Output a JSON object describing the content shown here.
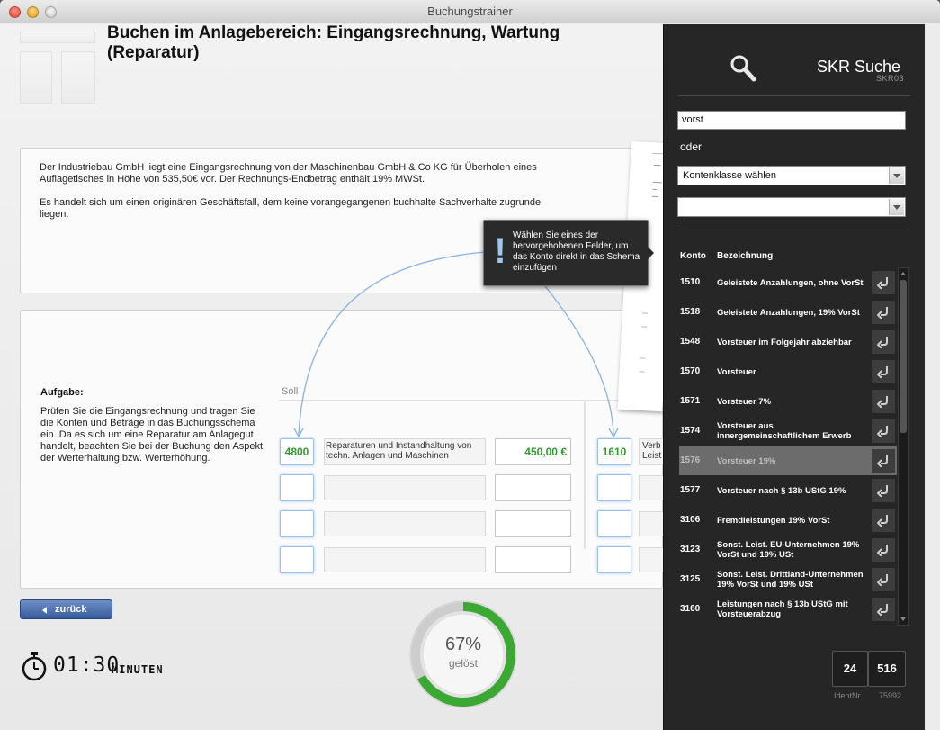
{
  "window": {
    "title": "Buchungstrainer"
  },
  "heading": "Buchen im Anlagebereich: Eingangsrechnung, Wartung (Reparatur)",
  "description": {
    "p1": "Der Industriebau GmbH liegt eine Eingangsrechnung von der Maschinenbau GmbH & Co KG für Überholen eines Auflagetisches in Höhe von 535,50€ vor. Der Rechnungs-Endbetrag enthält 19% MWSt.",
    "p2": "Es handelt sich um einen originären Geschäftsfall, dem keine vorangegangenen buchhalte Sachverhalte zugrunde liegen."
  },
  "task": {
    "label": "Aufgabe:",
    "text": "Prüfen Sie die Eingangsrechnung und tragen Sie die Konten und Beträge in das Buchungsschema ein. Da es sich um eine Reparatur am Anlagegut handelt, beachten Sie bei der Buchung den Aspekt der Werterhaltung bzw. Werterhöhung."
  },
  "schema": {
    "soll_label": "Soll",
    "row1": {
      "soll_account": "4800",
      "soll_description": "Reparaturen und Instandhaltung von techn. Anlagen und Maschinen",
      "soll_amount": "450,00 €",
      "haben_account": "1610",
      "haben_description_clipped": "Verb\nLeist"
    }
  },
  "tooltip": {
    "text": "Wählen Sie eines der hervorgehobenen Felder, um das Konto direkt in das Schema einzufügen"
  },
  "back_button": {
    "label": "zurück"
  },
  "timer": {
    "time": "01:30",
    "unit": "MINUTEN"
  },
  "progress": {
    "value": 0.67,
    "label": "67%",
    "sub": "gelöst",
    "color": "#3aa832"
  },
  "sidebar": {
    "title": "SKR Suche",
    "subtitle": "SKR03",
    "search_value": "vorst",
    "or_label": "oder",
    "class_select": "Kontenklasse wählen",
    "second_select": "",
    "columns": {
      "konto": "Konto",
      "bezeichnung": "Bezeichnung"
    },
    "rows": [
      {
        "konto": "1510",
        "bezeichnung": "Geleistete Anzahlungen, ohne VorSt"
      },
      {
        "konto": "1518",
        "bezeichnung": "Geleistete Anzahlungen, 19% VorSt"
      },
      {
        "konto": "1548",
        "bezeichnung": "Vorsteuer im Folgejahr abziehbar"
      },
      {
        "konto": "1570",
        "bezeichnung": "Vorsteuer"
      },
      {
        "konto": "1571",
        "bezeichnung": "Vorsteuer 7%"
      },
      {
        "konto": "1574",
        "bezeichnung": "Vorsteuer aus innergemeinschaftlichem Erwerb"
      },
      {
        "konto": "1576",
        "bezeichnung": "Vorsteuer 19%"
      },
      {
        "konto": "1577",
        "bezeichnung": "Vorsteuer nach § 13b UStG 19%"
      },
      {
        "konto": "3106",
        "bezeichnung": "Fremdleistungen 19% VorSt"
      },
      {
        "konto": "3123",
        "bezeichnung": "Sonst. Leist. EU-Unternehmen 19% VorSt und 19% USt"
      },
      {
        "konto": "3125",
        "bezeichnung": "Sonst. Leist. Drittland-Unternehmen 19% VorSt und 19% USt"
      },
      {
        "konto": "3160",
        "bezeichnung": "Leistungen nach § 13b UStG mit Vorsteuerabzug"
      }
    ],
    "selected_konto": "1576",
    "ident": {
      "a": "24",
      "b": "516",
      "label": "IdentNr.",
      "number": "75992"
    }
  }
}
